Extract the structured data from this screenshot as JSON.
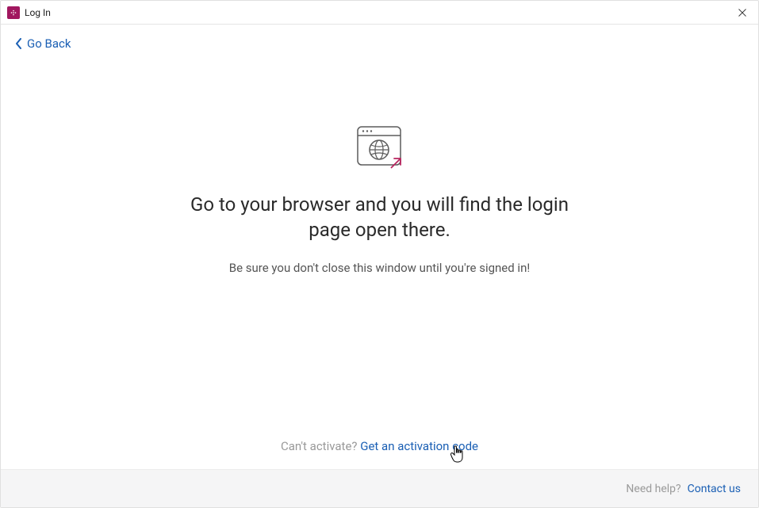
{
  "window": {
    "title": "Log In"
  },
  "nav": {
    "go_back": "Go Back"
  },
  "main": {
    "heading": "Go to your browser and you will find the login page open there.",
    "subtext": "Be sure you don't close this window until you're signed in!"
  },
  "activation": {
    "prompt": "Can't activate?",
    "link": "Get an activation code"
  },
  "footer": {
    "prompt": "Need help?",
    "link": "Contact us"
  }
}
